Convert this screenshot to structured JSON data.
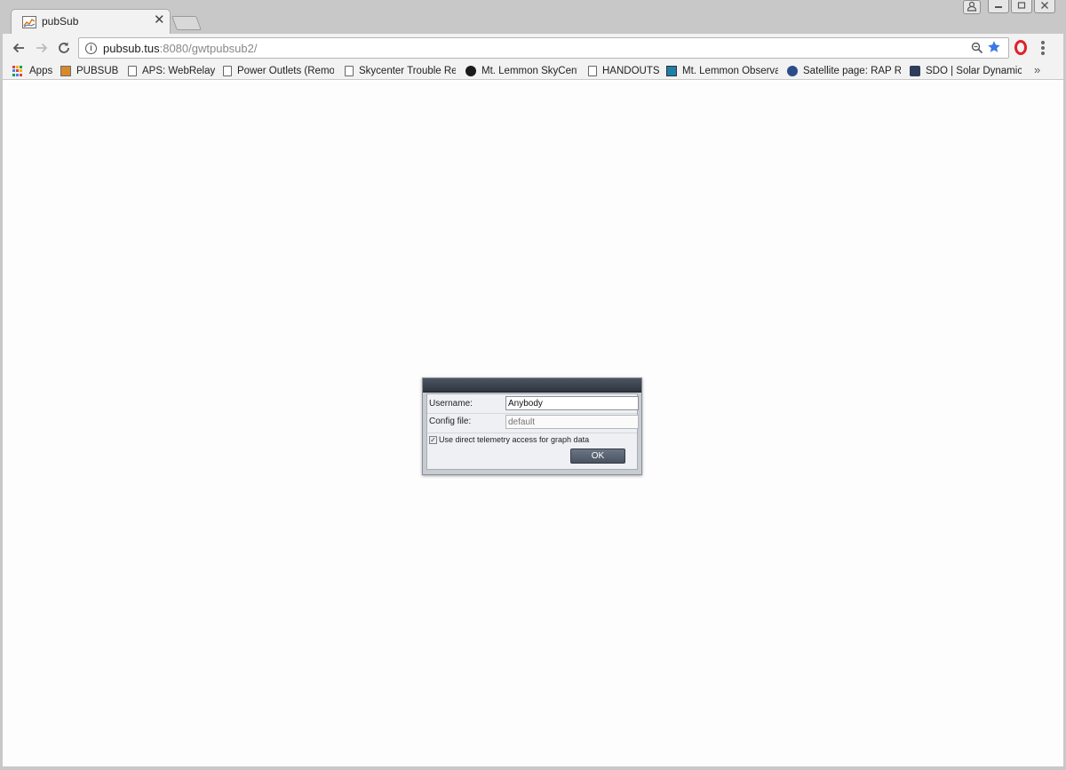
{
  "tab": {
    "title": "pubSub",
    "close_glyph": "✕"
  },
  "address_bar": {
    "host": "pubsub.tus",
    "rest": ":8080/gwtpubsub2/"
  },
  "bookmarks": [
    {
      "label": "Apps",
      "icon": "apps-grid-icon"
    },
    {
      "label": "PUBSUB!",
      "icon": "chart-icon"
    },
    {
      "label": "APS: WebRelays",
      "icon": "page-icon"
    },
    {
      "label": "Power Outlets (Remot",
      "icon": "page-icon"
    },
    {
      "label": "Skycenter Trouble Rep",
      "icon": "page-icon"
    },
    {
      "label": "Mt. Lemmon SkyCente",
      "icon": "dark-circle-icon"
    },
    {
      "label": "HANDOUTS",
      "icon": "page-icon"
    },
    {
      "label": "Mt. Lemmon Observa",
      "icon": "observatory-icon"
    },
    {
      "label": "Satellite page: RAP Re",
      "icon": "globe-icon"
    },
    {
      "label": "SDO | Solar Dynamics",
      "icon": "sdo-icon"
    }
  ],
  "bookmarks_more": "»",
  "login_dialog": {
    "username_label": "Username:",
    "username_value": "Anybody",
    "config_label": "Config file:",
    "config_placeholder": "default",
    "telemetry_label": "Use direct telemetry access for graph data",
    "telemetry_checked": true,
    "ok_label": "OK"
  }
}
